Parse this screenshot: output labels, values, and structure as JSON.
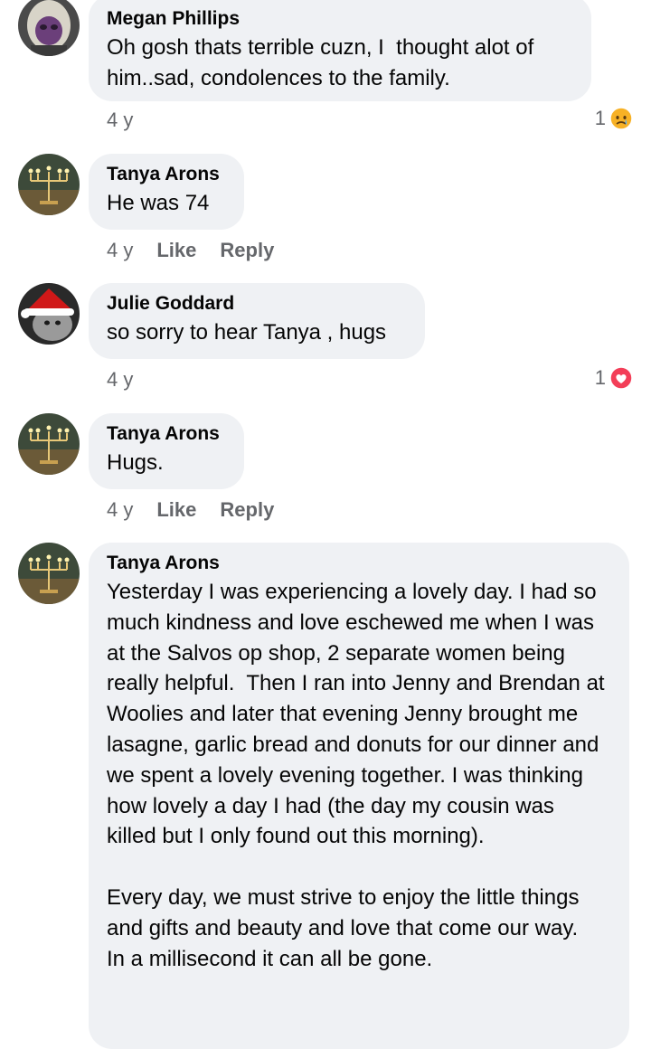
{
  "comments": [
    {
      "author": "Megan Phillips",
      "text": "Oh gosh thats terrible cuzn, I  thought alot of him..sad, condolences to the family.",
      "time": "4 y",
      "reaction_count": "1",
      "reaction_icon": "sad-face-icon"
    },
    {
      "author": "Tanya Arons",
      "text": "He was 74",
      "time": "4 y",
      "like_label": "Like",
      "reply_label": "Reply"
    },
    {
      "author": "Julie Goddard",
      "text": "so sorry to hear Tanya , hugs",
      "time": "4 y",
      "reaction_count": "1",
      "reaction_icon": "love-heart-icon"
    },
    {
      "author": "Tanya Arons",
      "text": "Hugs.",
      "time": "4 y",
      "like_label": "Like",
      "reply_label": "Reply"
    },
    {
      "author": "Tanya Arons",
      "text": "Yesterday I was experiencing a lovely day. I had so much kindness and love eschewed me when I was at the Salvos op shop, 2 separate women being really helpful.  Then I ran into Jenny and Brendan at Woolies and later that evening Jenny brought me lasagne, garlic bread and donuts for our dinner and we spent a lovely evening together. I was thinking how lovely a day I had (the day my cousin was killed but I only found out this morning).\n\nEvery day, we must strive to enjoy the little things and gifts and beauty and love that come our way.  In a millisecond it can all be gone."
    }
  ],
  "colors": {
    "bubble": "#eff1f4",
    "meta_text": "#65676b",
    "love_red": "#f33e58",
    "sad_yellow": "#f7b125"
  }
}
